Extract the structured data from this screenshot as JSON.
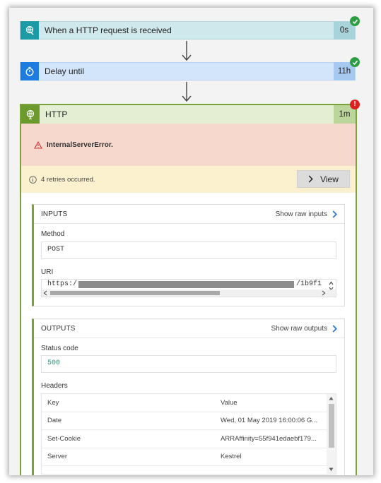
{
  "steps": {
    "http_request": {
      "title": "When a HTTP request is received",
      "duration": "0s",
      "status": "succeeded"
    },
    "delay": {
      "title": "Delay until",
      "duration": "11h",
      "status": "succeeded"
    },
    "http": {
      "title": "HTTP",
      "duration": "1m",
      "status": "failed",
      "error_badge": "!"
    }
  },
  "error": {
    "message": "InternalServerError."
  },
  "retries": {
    "message": "4 retries occurred.",
    "view_label": "View"
  },
  "inputs": {
    "title": "INPUTS",
    "raw_link": "Show raw inputs",
    "method_label": "Method",
    "method_value": "POST",
    "uri_label": "URI",
    "uri_start": "https:/",
    "uri_end": "/1b9f1"
  },
  "outputs": {
    "title": "OUTPUTS",
    "raw_link": "Show raw outputs",
    "status_label": "Status code",
    "status_value": "500",
    "headers_label": "Headers",
    "headers_columns": {
      "key": "Key",
      "value": "Value"
    },
    "headers_rows": [
      {
        "key": "Date",
        "value": "Wed, 01 May 2019 16:00:06 G..."
      },
      {
        "key": "Set-Cookie",
        "value": "ARRAffinity=55f941edaebf179..."
      },
      {
        "key": "Server",
        "value": "Kestrel"
      }
    ]
  },
  "colors": {
    "success": "#2e9e43",
    "error": "#e02020",
    "http_accent": "#6d9a2c",
    "link_chevron": "#1e6fd0",
    "status_code_text": "#2a8f7a"
  }
}
